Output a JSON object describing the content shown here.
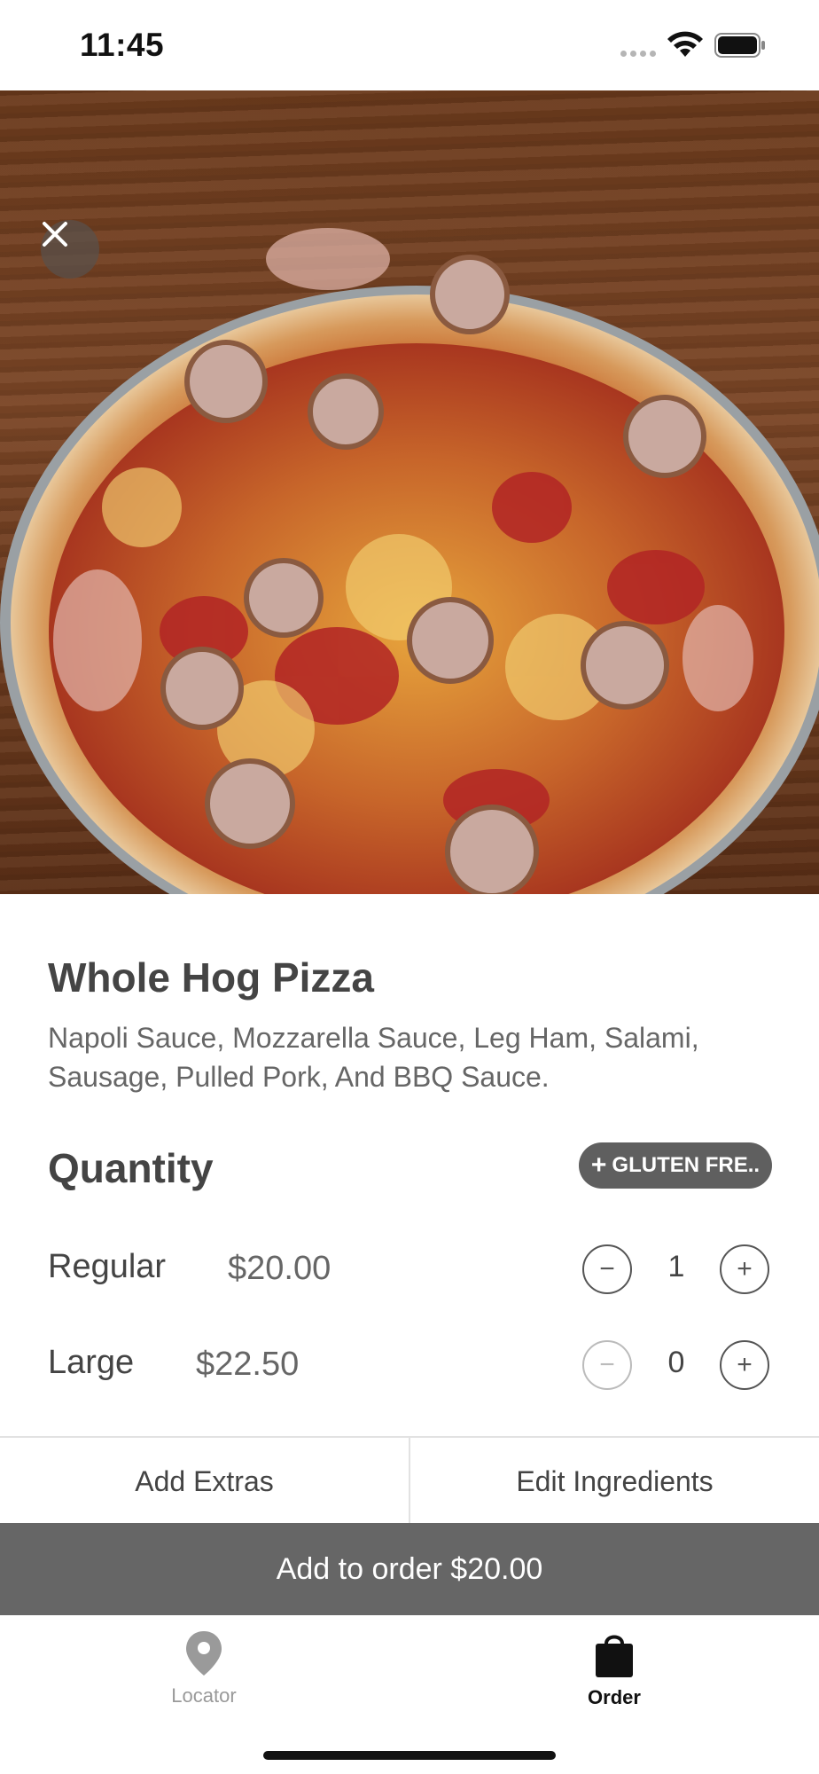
{
  "status_bar": {
    "time": "11:45"
  },
  "product": {
    "name": "Whole Hog Pizza",
    "description": "Napoli Sauce, Mozzarella Sauce, Leg Ham, Salami, Sausage, Pulled Pork, And BBQ Sauce."
  },
  "quantity": {
    "title": "Quantity",
    "gluten_free_label": "GLUTEN FRE..",
    "sizes": [
      {
        "label": "Regular",
        "price": "$20.00",
        "qty": "1",
        "minus": "−",
        "plus": "+"
      },
      {
        "label": "Large",
        "price": "$22.50",
        "qty": "0",
        "minus": "−",
        "plus": "+"
      }
    ]
  },
  "actions": {
    "add_extras": "Add Extras",
    "edit_ingredients": "Edit Ingredients",
    "add_to_order": "Add to order $20.00"
  },
  "tabbar": {
    "items": [
      {
        "label": "Locator",
        "icon": "location-pin-icon",
        "active": false
      },
      {
        "label": "Order",
        "icon": "shopping-bag-icon",
        "active": true
      }
    ]
  },
  "colors": {
    "accent": "#666666",
    "pill": "#5f5f5f",
    "text": "#444444",
    "muted": "#999999"
  }
}
